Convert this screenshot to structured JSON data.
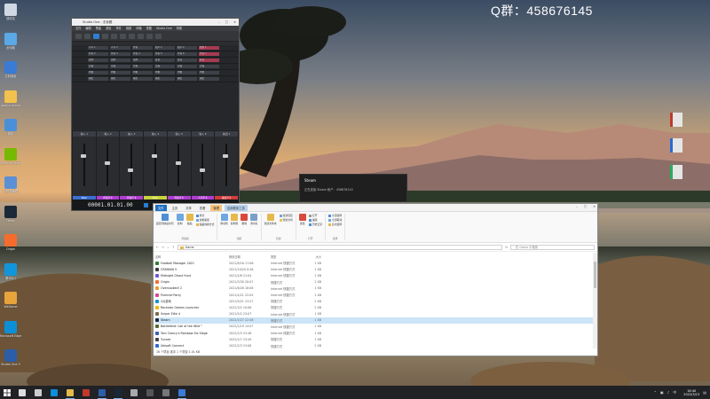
{
  "watermark": "Q群：458676145",
  "desktop_icons": [
    {
      "label": "回收站",
      "color": "#cfd8e3"
    },
    {
      "label": "此电脑",
      "color": "#5aa9e6"
    },
    {
      "label": "控制面板",
      "color": "#3a7bd5"
    },
    {
      "label": "Administrator",
      "color": "#f2c14e"
    },
    {
      "label": "网络",
      "color": "#4a90d9"
    },
    {
      "label": "GeForce Experience",
      "color": "#76b900"
    },
    {
      "label": "计算机管理",
      "color": "#5b8fd6"
    },
    {
      "label": "Steam",
      "color": "#1b2838"
    },
    {
      "label": "Origin",
      "color": "#f56c2d"
    },
    {
      "label": "腾讯QQ",
      "color": "#1296db"
    },
    {
      "label": "WeGame",
      "color": "#e8a33d"
    },
    {
      "label": "Microsoft Edge",
      "color": "#0c8fd6"
    },
    {
      "label": "Studio One 5",
      "color": "#2b5ea7"
    }
  ],
  "studio_one": {
    "title": "Studio One - 无标题",
    "menu": [
      "文件",
      "编辑",
      "歌曲",
      "音轨",
      "事件",
      "音频",
      "传输",
      "视图",
      "Studio One",
      "帮助"
    ],
    "tracks": [
      [
        "人声 1",
        "人声 2",
        "伴奏",
        "和声 1",
        "和声 2",
        "效果 1"
      ],
      [
        "伴奏 2",
        "伴奏 3",
        "伴奏 4",
        "伴奏 5",
        "伴奏 6",
        "伴奏 7"
      ],
      [
        "混响",
        "混响",
        "混响",
        "延迟",
        "延迟",
        "延迟"
      ],
      [
        "压缩",
        "压缩",
        "压缩",
        "压缩",
        "压缩",
        "压缩"
      ],
      [
        "均衡",
        "均衡",
        "均衡",
        "均衡",
        "均衡",
        "均衡"
      ],
      [
        "输出",
        "输出",
        "输出",
        "输出",
        "输出",
        "输出"
      ]
    ],
    "mixer_strips": [
      {
        "name": "输入 1",
        "color_label": "Main",
        "color": "#3c6fd1"
      },
      {
        "name": "输入 2",
        "color_label": "伴奏声卡",
        "color": "#b03dd1"
      },
      {
        "name": "输入 3",
        "color_label": "伴奏声卡",
        "color": "#b03dd1"
      },
      {
        "name": "输入 4",
        "color_label": "Main",
        "color": "#c8d23c"
      },
      {
        "name": "输入 5",
        "color_label": "伴奏声卡",
        "color": "#b03dd1"
      },
      {
        "name": "输入 6",
        "color_label": "人声声卡",
        "color": "#b03dd1"
      },
      {
        "name": "输出 1",
        "color_label": "输出声卡",
        "color": "#d13c3c"
      }
    ],
    "timecode": "00001.01.01.00"
  },
  "toast": {
    "title": "Steam",
    "message": "正在连接 Steam 帐户：458676145"
  },
  "explorer": {
    "tabs": [
      "文件",
      "主页",
      "共享",
      "查看",
      "管理",
      "应用程序工具"
    ],
    "ribbon_groups": [
      {
        "name": "剪贴板",
        "big": [
          "固定到快速访问",
          "复制",
          "粘贴"
        ],
        "small": [
          "剪切",
          "复制路径",
          "粘贴快捷方式"
        ]
      },
      {
        "name": "组织",
        "big": [
          "移动到",
          "复制到",
          "删除",
          "重命名"
        ],
        "small": []
      },
      {
        "name": "新建",
        "big": [
          "新建文件夹"
        ],
        "small": [
          "新建项目",
          "轻松访问"
        ]
      },
      {
        "name": "打开",
        "big": [
          "属性"
        ],
        "small": [
          "打开",
          "编辑",
          "历史记录"
        ]
      },
      {
        "name": "选择",
        "big": [],
        "small": [
          "全部选择",
          "全部取消",
          "反向选择"
        ]
      }
    ],
    "path": "Game",
    "search_placeholder": "在 Game 中搜索",
    "columns": [
      "名称",
      "修改日期",
      "类型",
      "大小"
    ],
    "files": [
      {
        "name": "Football Manager 2021",
        "date": "2021/8/16 17:06",
        "type": "Internet 快捷方式",
        "size": "1 KB",
        "color": "#2e7d32"
      },
      {
        "name": "GTAMAIN 5",
        "date": "2021/10/20 0:46",
        "type": "Internet 快捷方式",
        "size": "1 KB",
        "color": "#3c3c3c"
      },
      {
        "name": "Midnight Ghost Hunt",
        "date": "2021/4/6 21:04",
        "type": "Internet 快捷方式",
        "size": "1 KB",
        "color": "#6a5acd"
      },
      {
        "name": "Origin",
        "date": "2021/3/30 20:07",
        "type": "快捷方式",
        "size": "2 KB",
        "color": "#f56c2d"
      },
      {
        "name": "Overcooked! 2",
        "date": "2021/6/28 18:08",
        "type": "Internet 快捷方式",
        "size": "1 KB",
        "color": "#e0a030"
      },
      {
        "name": "Pummel Party",
        "date": "2021/4/21 22:05",
        "type": "Internet 快捷方式",
        "size": "1 KB",
        "color": "#d94a8c"
      },
      {
        "name": "QQ游戏",
        "date": "2021/9/21 23:27",
        "type": "快捷方式",
        "size": "2 KB",
        "color": "#1296db"
      },
      {
        "name": "Rockstar Games Launcher",
        "date": "2022/3/2 10:08",
        "type": "快捷方式",
        "size": "2 KB",
        "color": "#f4b400"
      },
      {
        "name": "Sniper Elite 4",
        "date": "2021/5/2 23:07",
        "type": "Internet 快捷方式",
        "size": "1 KB",
        "color": "#7a6a4a"
      },
      {
        "name": "Steam",
        "date": "2022/2/27 22:48",
        "type": "快捷方式",
        "size": "1 KB",
        "color": "#1b2838"
      },
      {
        "name": "Battlefield: Call of the Wild™",
        "date": "2022/2/19 14:07",
        "type": "Internet 快捷方式",
        "size": "1 KB",
        "color": "#556b2f"
      },
      {
        "name": "Tom Clancy's Rainbow Six Siege",
        "date": "2022/2/3 23:48",
        "type": "Internet 快捷方式",
        "size": "1 KB",
        "color": "#3a5fb0"
      },
      {
        "name": "Tunnet",
        "date": "2022/2/7 23:49",
        "type": "快捷方式",
        "size": "1 KB",
        "color": "#444"
      },
      {
        "name": "Ubisoft Connect",
        "date": "2022/2/3 23:08",
        "type": "快捷方式",
        "size": "2 KB",
        "color": "#2a6ad0"
      }
    ],
    "selected_index": 9,
    "status": "16 个项目    选中 1 个项目 1.01 KB    "
  },
  "taskbar": {
    "apps": [
      {
        "name": "search",
        "color": "#ddd"
      },
      {
        "name": "task-view",
        "color": "#ccc"
      },
      {
        "name": "edge",
        "color": "#0c8fd6"
      },
      {
        "name": "explorer",
        "color": "#e5b94b"
      },
      {
        "name": "store",
        "color": "#c0392b"
      },
      {
        "name": "studio-one",
        "color": "#2b5ea7"
      },
      {
        "name": "steam",
        "color": "#1b2838"
      },
      {
        "name": "app-8",
        "color": "#aaa"
      },
      {
        "name": "app-9",
        "color": "#555"
      },
      {
        "name": "app-10",
        "color": "#777"
      },
      {
        "name": "app-11",
        "color": "#3a7bd5"
      }
    ],
    "clock_time": "18:40",
    "clock_date": "2022/3/13",
    "ime": "中"
  }
}
